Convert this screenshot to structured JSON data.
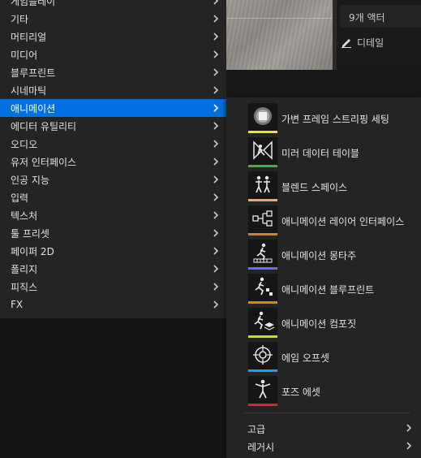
{
  "viewport": {
    "actor_count": "9개 액터",
    "details_tab": "디테일"
  },
  "categories": [
    {
      "label": "게임플레이",
      "active": false
    },
    {
      "label": "기타",
      "active": false
    },
    {
      "label": "머티리얼",
      "active": false
    },
    {
      "label": "미디어",
      "active": false
    },
    {
      "label": "블루프린트",
      "active": false
    },
    {
      "label": "시네마틱",
      "active": false
    },
    {
      "label": "애니메이션",
      "active": true
    },
    {
      "label": "에디터 유틸리티",
      "active": false
    },
    {
      "label": "오디오",
      "active": false
    },
    {
      "label": "유저 인터페이스",
      "active": false
    },
    {
      "label": "인공 지능",
      "active": false
    },
    {
      "label": "입력",
      "active": false
    },
    {
      "label": "텍스처",
      "active": false
    },
    {
      "label": "툴 프리셋",
      "active": false
    },
    {
      "label": "페이퍼 2D",
      "active": false
    },
    {
      "label": "폴리지",
      "active": false
    },
    {
      "label": "피직스",
      "active": false
    },
    {
      "label": "FX",
      "active": false
    }
  ],
  "submenu": {
    "items": [
      {
        "label": "가변 프레임 스트리핑 세팅",
        "icon": "variable-frame-strip-icon",
        "color": "#f4e21a"
      },
      {
        "label": "미러 데이터 테이블",
        "icon": "mirror-data-table-icon",
        "color": "#3fb43b"
      },
      {
        "label": "블렌드 스페이스",
        "icon": "blend-space-icon",
        "color": "#f5a46a"
      },
      {
        "label": "애니메이션 레이어 인터페이스",
        "icon": "anim-layer-interface-icon",
        "color": "#d9821c"
      },
      {
        "label": "애니메이션 몽타주",
        "icon": "anim-montage-icon",
        "color": "#6b6cf0"
      },
      {
        "label": "애니메이션 블루프린트",
        "icon": "anim-blueprint-icon",
        "color": "#d9821c"
      },
      {
        "label": "애니메이션 컴포짓",
        "icon": "anim-composite-icon",
        "color": "#b8e21a"
      },
      {
        "label": "에임 오프셋",
        "icon": "aim-offset-icon",
        "color": "#19a0ea"
      },
      {
        "label": "포즈 에셋",
        "icon": "pose-asset-icon",
        "color": "#e2242a"
      }
    ],
    "footer": [
      {
        "label": "고급"
      },
      {
        "label": "레거시"
      }
    ]
  }
}
